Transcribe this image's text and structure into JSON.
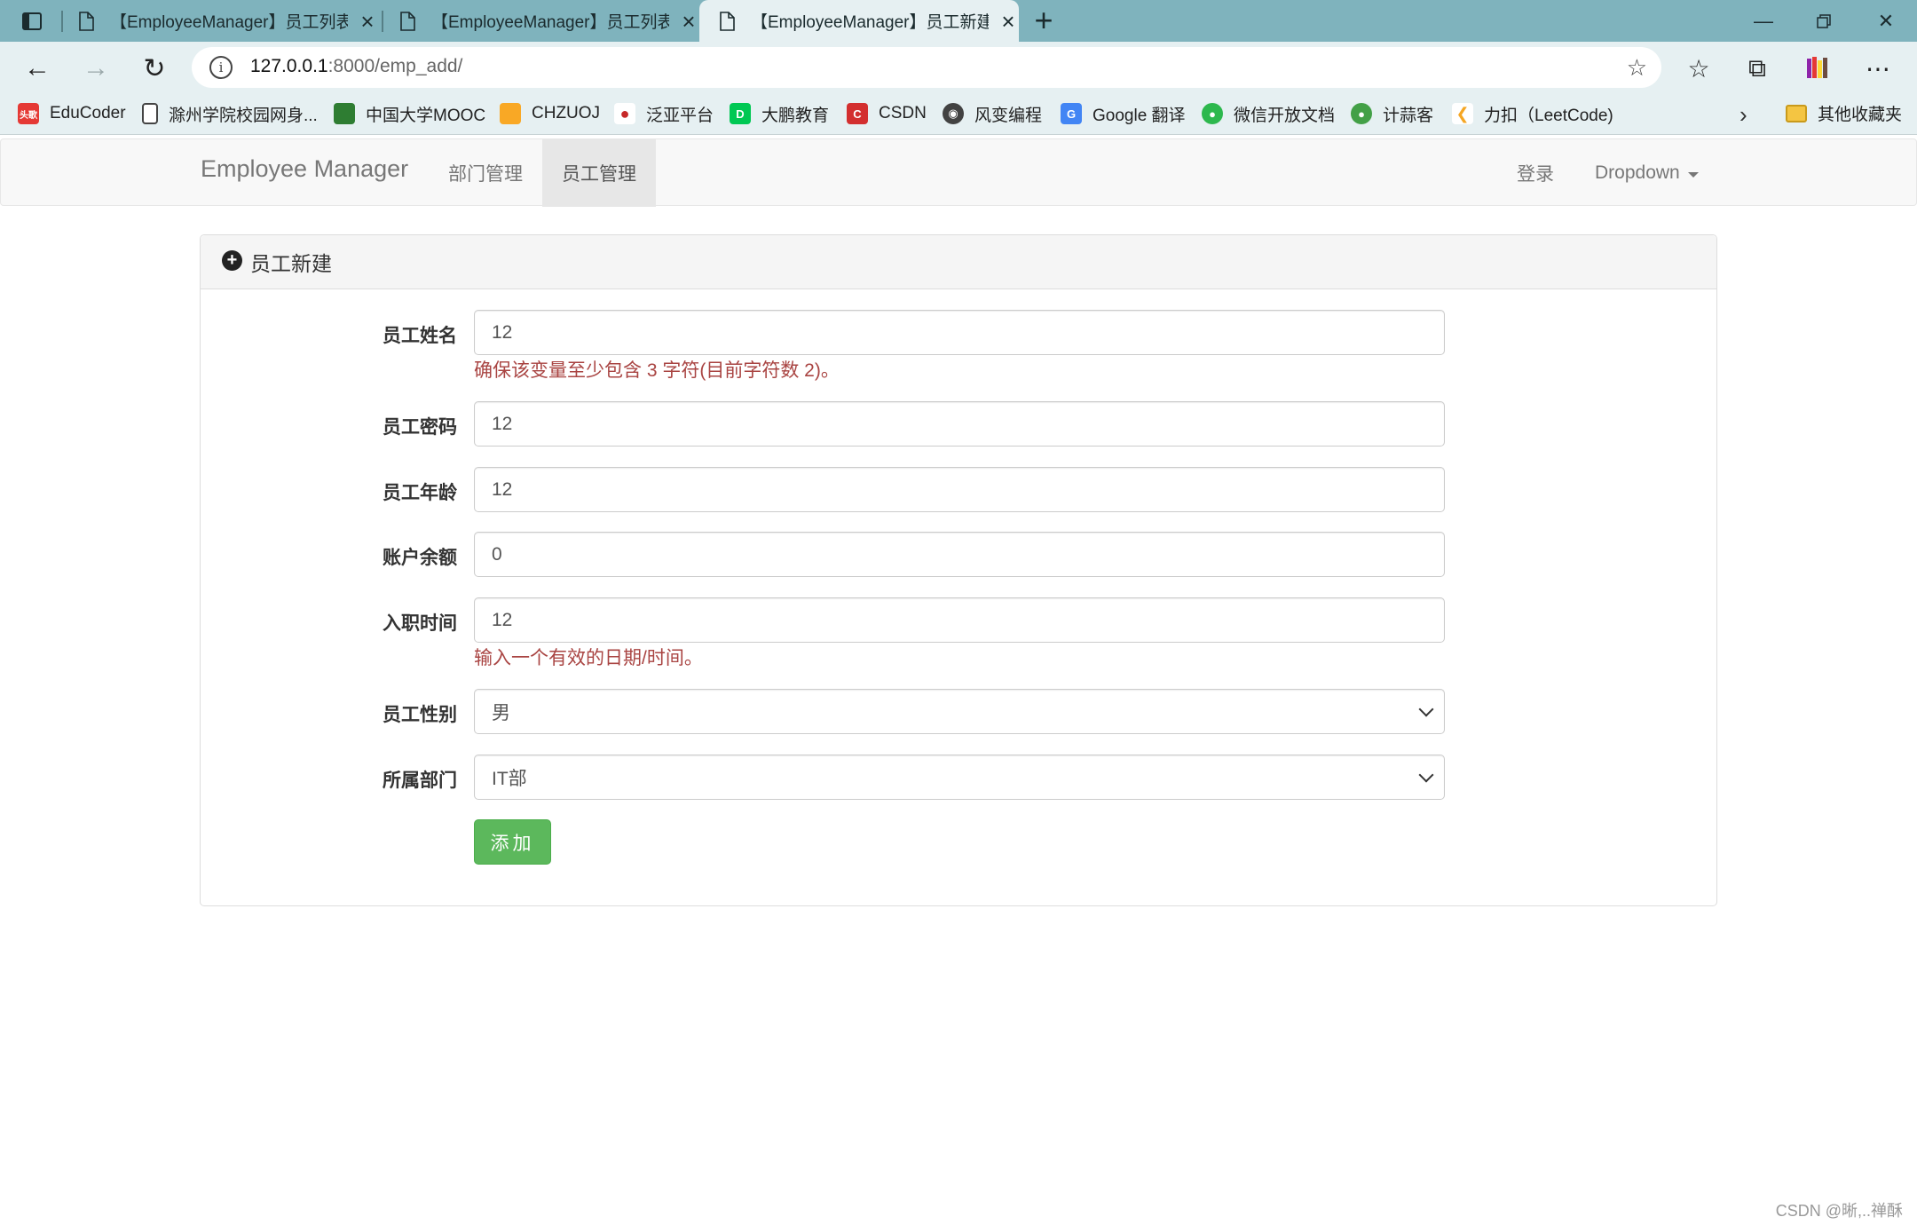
{
  "browser": {
    "tabs": [
      {
        "title": "【EmployeeManager】员工列表",
        "active": false
      },
      {
        "title": "【EmployeeManager】员工列表",
        "active": false
      },
      {
        "title": "【EmployeeManager】员工新建",
        "active": true
      }
    ],
    "url_host": "127.0.0.1",
    "url_path": ":8000/emp_add/",
    "bookmarks": [
      {
        "label": "EduCoder",
        "color": "#e53935",
        "glyph": "头歌"
      },
      {
        "label": "滁州学院校园网身...",
        "color": "#ffffff",
        "glyph": ""
      },
      {
        "label": "中国大学MOOC",
        "color": "#2e7d32",
        "glyph": ""
      },
      {
        "label": "CHZUOJ",
        "color": "#f9a825",
        "glyph": ""
      },
      {
        "label": "泛亚平台",
        "color": "#c62828",
        "glyph": ""
      },
      {
        "label": "大鹏教育",
        "color": "#00c853",
        "glyph": ""
      },
      {
        "label": "CSDN",
        "color": "#d32f2f",
        "glyph": "C"
      },
      {
        "label": "风变编程",
        "color": "#424242",
        "glyph": ""
      },
      {
        "label": "Google 翻译",
        "color": "#4285f4",
        "glyph": "G"
      },
      {
        "label": "微信开放文档",
        "color": "#2db84d",
        "glyph": ""
      },
      {
        "label": "计蒜客",
        "color": "#43a047",
        "glyph": ""
      },
      {
        "label": "力扣（LeetCode)",
        "color": "#f5a623",
        "glyph": ""
      }
    ],
    "other_bookmarks": "其他收藏夹"
  },
  "navbar": {
    "brand": "Employee Manager",
    "links": [
      "部门管理",
      "员工管理"
    ],
    "active_link": "员工管理",
    "login": "登录",
    "dropdown": "Dropdown"
  },
  "panel": {
    "title": "员工新建"
  },
  "form": {
    "fields": [
      {
        "label": "员工姓名",
        "value": "12",
        "type": "text",
        "error": "确保该变量至少包含 3 字符(目前字符数 2)。"
      },
      {
        "label": "员工密码",
        "value": "12",
        "type": "text",
        "error": ""
      },
      {
        "label": "员工年龄",
        "value": "12",
        "type": "text",
        "error": ""
      },
      {
        "label": "账户余额",
        "value": "0",
        "type": "text",
        "error": ""
      },
      {
        "label": "入职时间",
        "value": "12",
        "type": "text",
        "error": "输入一个有效的日期/时间。"
      },
      {
        "label": "员工性别",
        "value": "男",
        "type": "select",
        "error": ""
      },
      {
        "label": "所属部门",
        "value": "IT部",
        "type": "select",
        "error": ""
      }
    ],
    "submit": "添加"
  },
  "watermark": "CSDN @晰,..禅酥",
  "colors": {
    "tabbar": "#7fb3bd",
    "toolbar": "#e6f0f2",
    "error": "#a94442",
    "success": "#5cb85c"
  }
}
